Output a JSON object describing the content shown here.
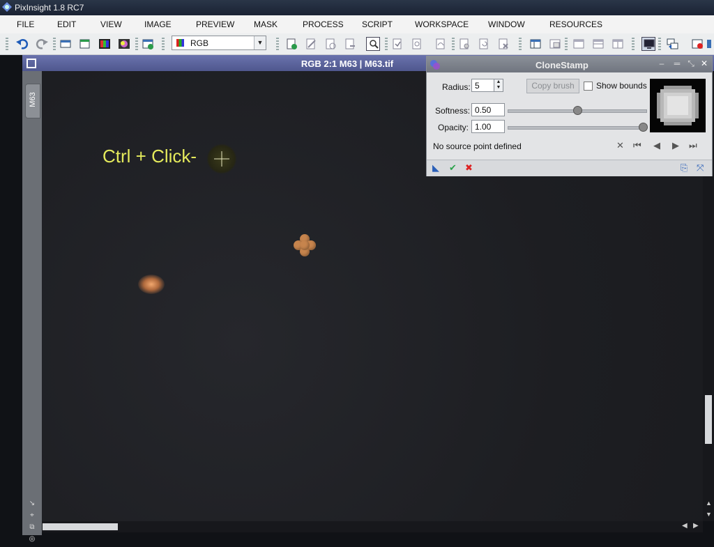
{
  "app": {
    "title": "PixInsight 1.8 RC7"
  },
  "menu": [
    "FILE",
    "EDIT",
    "VIEW",
    "IMAGE",
    "PREVIEW",
    "MASK",
    "PROCESS",
    "SCRIPT",
    "WORKSPACE",
    "WINDOW",
    "RESOURCES"
  ],
  "toolbar": {
    "channel_select": "RGB"
  },
  "image_window": {
    "title": "RGB 2:1 M63 | M63.tif",
    "side_tab": "M63",
    "overlay_hint": "Ctrl + Click-"
  },
  "clonestamp": {
    "title": "CloneStamp",
    "radius_label": "Radius:",
    "radius_value": "5",
    "copy_brush_label": "Copy brush",
    "show_bounds_label": "Show bounds",
    "softness_label": "Softness:",
    "softness_value": "0.50",
    "opacity_label": "Opacity:",
    "opacity_value": "1.00",
    "status": "No source point defined"
  }
}
